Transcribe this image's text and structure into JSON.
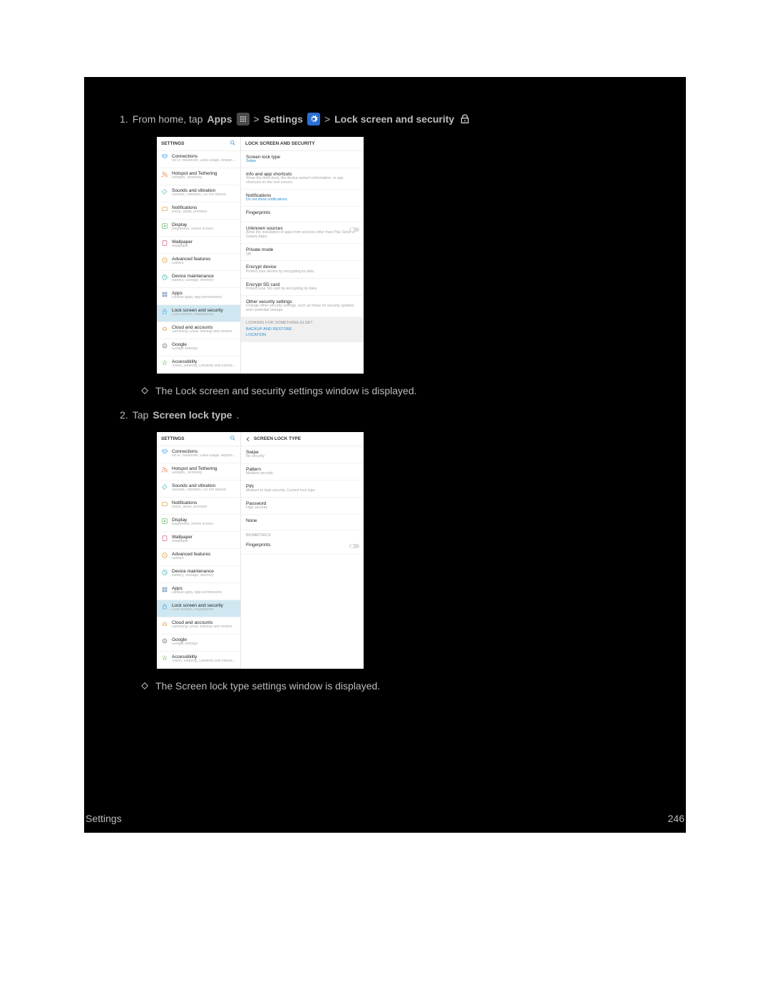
{
  "step1": {
    "num": "1.",
    "prefix": "From home, tap",
    "apps": "Apps",
    "gt1": ">",
    "settings": "Settings",
    "gt2": ">",
    "target": "Lock screen and security"
  },
  "bullet1": "The Lock screen and security settings window is displayed.",
  "step2": {
    "num": "2.",
    "prefix": "Tap",
    "target": "Screen lock type",
    "suffix": "."
  },
  "bullet2": "The Screen lock type settings window is displayed.",
  "footer": {
    "left": "Settings",
    "right": "246"
  },
  "sidebar_header": "SETTINGS",
  "sidebar_items": [
    {
      "title": "Connections",
      "sub": "Wi-Fi, Bluetooth, Data usage, Airplane m..."
    },
    {
      "title": "Hotspot and Tethering",
      "sub": "Hotspot, Tethering"
    },
    {
      "title": "Sounds and vibration",
      "sub": "Sounds, Vibration, Do not disturb"
    },
    {
      "title": "Notifications",
      "sub": "Block, allow, prioritize"
    },
    {
      "title": "Display",
      "sub": "Brightness, Home screen"
    },
    {
      "title": "Wallpaper",
      "sub": "Wallpaper"
    },
    {
      "title": "Advanced features",
      "sub": "Games"
    },
    {
      "title": "Device maintenance",
      "sub": "Battery, Storage, Memory"
    },
    {
      "title": "Apps",
      "sub": "Default apps, App permissions"
    },
    {
      "title": "Lock screen and security",
      "sub": "Lock screen, Fingerprints"
    },
    {
      "title": "Cloud and accounts",
      "sub": "Samsung Cloud, Backup and restore"
    },
    {
      "title": "Google",
      "sub": "Google settings"
    },
    {
      "title": "Accessibility",
      "sub": "Vision, Hearing, Dexterity and interaction"
    }
  ],
  "panel1": {
    "header": "LOCK SCREEN AND SECURITY",
    "rows": [
      {
        "title": "Screen lock type",
        "sub": "Swipe",
        "subClass": "link"
      },
      {
        "title": "Info and app shortcuts",
        "sub": "Show the dual clock, the device owner's information, or app shortcuts on the lock screen."
      },
      {
        "title": "Notifications",
        "sub": "Do not show notifications",
        "subClass": "link"
      },
      {
        "title": "Fingerprints",
        "sub": ""
      },
      {
        "title": "Unknown sources",
        "sub": "Allow the installation of apps from sources other than Play Store or Galaxy Apps.",
        "toggle": true
      },
      {
        "title": "Private mode",
        "sub": "Off"
      },
      {
        "title": "Encrypt device",
        "sub": "Protect your device by encrypting its data."
      },
      {
        "title": "Encrypt SD card",
        "sub": "Protect your SD card by encrypting its data."
      },
      {
        "title": "Other security settings",
        "sub": "Change other security settings, such as those for security updates and credential storage."
      }
    ],
    "looking_title": "LOOKING FOR SOMETHING ELSE?",
    "looking_links": [
      "BACKUP AND RESTORE",
      "LOCATION"
    ]
  },
  "panel2": {
    "header": "SCREEN LOCK TYPE",
    "rows": [
      {
        "title": "Swipe",
        "sub": "No security"
      },
      {
        "title": "Pattern",
        "sub": "Medium security"
      },
      {
        "title": "PIN",
        "sub": "Medium to high security. Current lock type."
      },
      {
        "title": "Password",
        "sub": "High security"
      },
      {
        "title": "None",
        "sub": ""
      }
    ],
    "bio_label": "BIOMETRICS",
    "bio_row": {
      "title": "Fingerprints",
      "sub": "",
      "toggle": true
    }
  }
}
